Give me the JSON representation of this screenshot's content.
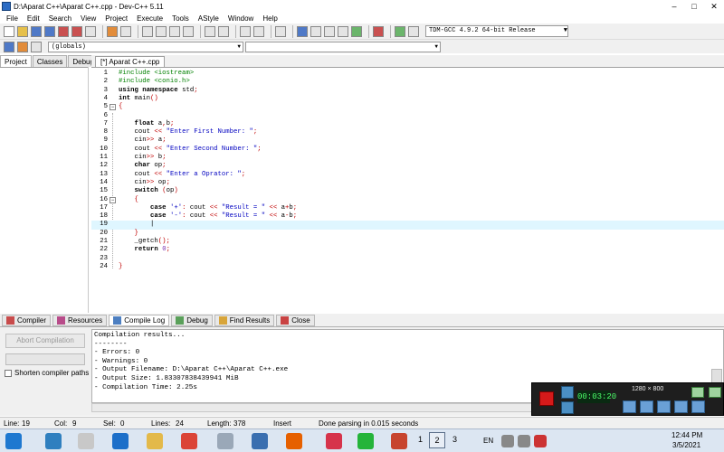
{
  "window": {
    "title": "D:\\Aparat C++\\Aparat C++.cpp - Dev-C++ 5.11",
    "minimize": "–",
    "maximize": "□",
    "close": "✕"
  },
  "menu": [
    "File",
    "Edit",
    "Search",
    "View",
    "Project",
    "Execute",
    "Tools",
    "AStyle",
    "Window",
    "Help"
  ],
  "toolbar": {
    "compiler": "TDM-GCC 4.9.2 64-bit Release",
    "globals": "(globals)"
  },
  "left_panel": {
    "tabs": [
      "Project",
      "Classes",
      "Debug"
    ]
  },
  "editor": {
    "tab": "[*] Aparat C++.cpp",
    "current_line": 19
  },
  "bottom_panel": {
    "tabs": [
      "Compiler",
      "Resources",
      "Compile Log",
      "Debug",
      "Find Results",
      "Close"
    ],
    "abort_label": "Abort Compilation",
    "shorten_label": "Shorten compiler paths",
    "log": [
      "Compilation results...",
      "--------",
      "- Errors: 0",
      "- Warnings: 0",
      "- Output Filename: D:\\Aparat C++\\Aparat C++.exe",
      "- Output Size: 1.83307838439941 MiB",
      "- Compilation Time: 2.25s"
    ]
  },
  "status": {
    "line_label": "Line:",
    "line": "19",
    "col_label": "Col:",
    "col": "9",
    "sel_label": "Sel:",
    "sel": "0",
    "lines_label": "Lines:",
    "lines": "24",
    "length_label": "Length:",
    "length": "378",
    "mode": "Insert",
    "message": "Done parsing in 0.015 seconds"
  },
  "recorder": {
    "timer": "00:03:20",
    "resolution": "1280 × 800"
  },
  "taskbar": {
    "lang": "EN",
    "time": "12:44 PM",
    "date": "3/5/2021",
    "pages": [
      "1",
      "2",
      "3"
    ]
  }
}
